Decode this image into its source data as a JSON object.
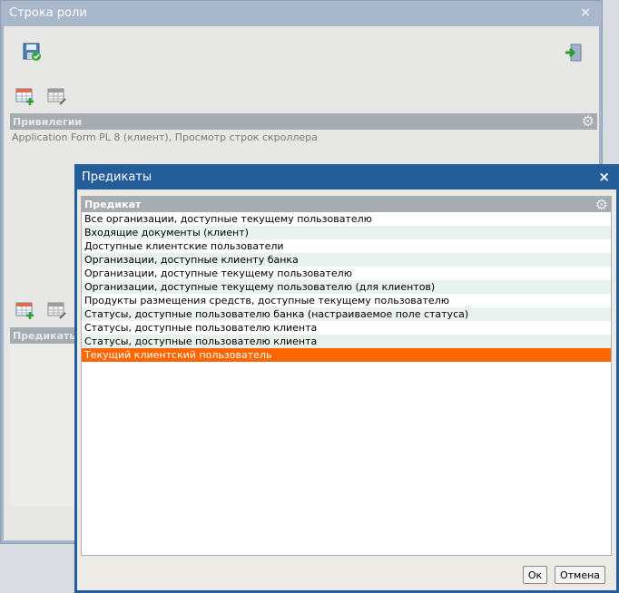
{
  "background_window": {
    "title": "Строка роли",
    "privileges_header": "Привилегии",
    "privileges_row": "Application Form PL 8 (клиент), Просмотр строк скроллера",
    "predicates_header": "Предикаты"
  },
  "dialog": {
    "title": "Предикаты",
    "column_header": "Предикат",
    "rows": [
      "Все организации, доступные текущему пользователю",
      "Входящие документы (клиент)",
      "Доступные клиентские пользователи",
      "Организации, доступные клиенту банка",
      "Организации, доступные текущему пользователю",
      "Организации, доступные текущему пользователю (для клиентов)",
      "Продукты размещения средств, доступные текущему пользователю",
      "Статусы, доступные пользователю банка (настраиваемое поле статуса)",
      "Статусы, доступные пользователю клиента",
      "Статусы, доступные пользователю клиента",
      "Текущий клиентский пользователь"
    ],
    "selected_index": 10,
    "ok_label": "Ок",
    "cancel_label": "Отмена"
  },
  "colors": {
    "selection": "#ff6600",
    "dialog_frame": "#235e9b",
    "grid_header": "#a7acb1"
  }
}
